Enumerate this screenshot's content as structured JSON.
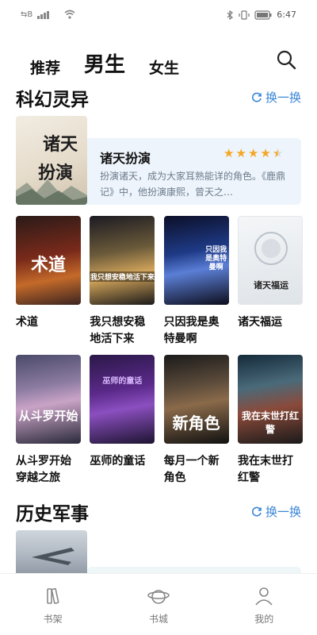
{
  "status_bar": {
    "time": "6:47",
    "left_badge": "⇆B"
  },
  "tabs": [
    {
      "label": "推荐",
      "active": false
    },
    {
      "label": "男生",
      "active": true
    },
    {
      "label": "女生",
      "active": false
    }
  ],
  "search": {
    "icon": "search-icon"
  },
  "sections": [
    {
      "title": "科幻灵异",
      "refresh_label": "换一换"
    },
    {
      "title": "历史军事",
      "refresh_label": "换一换"
    }
  ],
  "featured": {
    "title": "诸天扮演",
    "rating": 4.5,
    "description": "扮演诸天，成为大家耳熟能详的角色。《鹿鼎记》中，他扮演康熙，曾天之…",
    "cover_text": [
      "诸天",
      "扮演"
    ]
  },
  "books_row1": [
    {
      "title": "术道",
      "cover_text": "术道"
    },
    {
      "title": "我只想安稳地活下来",
      "cover_text": "我只想安稳地活下来"
    },
    {
      "title": "只因我是奥特曼啊",
      "cover_text": "只因我是奥特曼啊"
    },
    {
      "title": "诸天福运",
      "cover_text": "诸天福运"
    }
  ],
  "books_row2": [
    {
      "title": "从斗罗开始穿越之旅",
      "cover_text": "从斗罗开始"
    },
    {
      "title": "巫师的童话",
      "cover_text": "巫师的童话"
    },
    {
      "title": "每月一个新角色",
      "cover_text": "新角色"
    },
    {
      "title": "我在末世打红警",
      "cover_text": "我在末世打红警"
    }
  ],
  "bottom_nav": [
    {
      "label": "书架",
      "icon": "bookshelf-icon"
    },
    {
      "label": "书城",
      "icon": "bookstore-icon"
    },
    {
      "label": "我的",
      "icon": "profile-icon"
    }
  ],
  "colors": {
    "accent": "#3a86d6",
    "star": "#f5a623",
    "featured_bg": "#eef4fb"
  }
}
